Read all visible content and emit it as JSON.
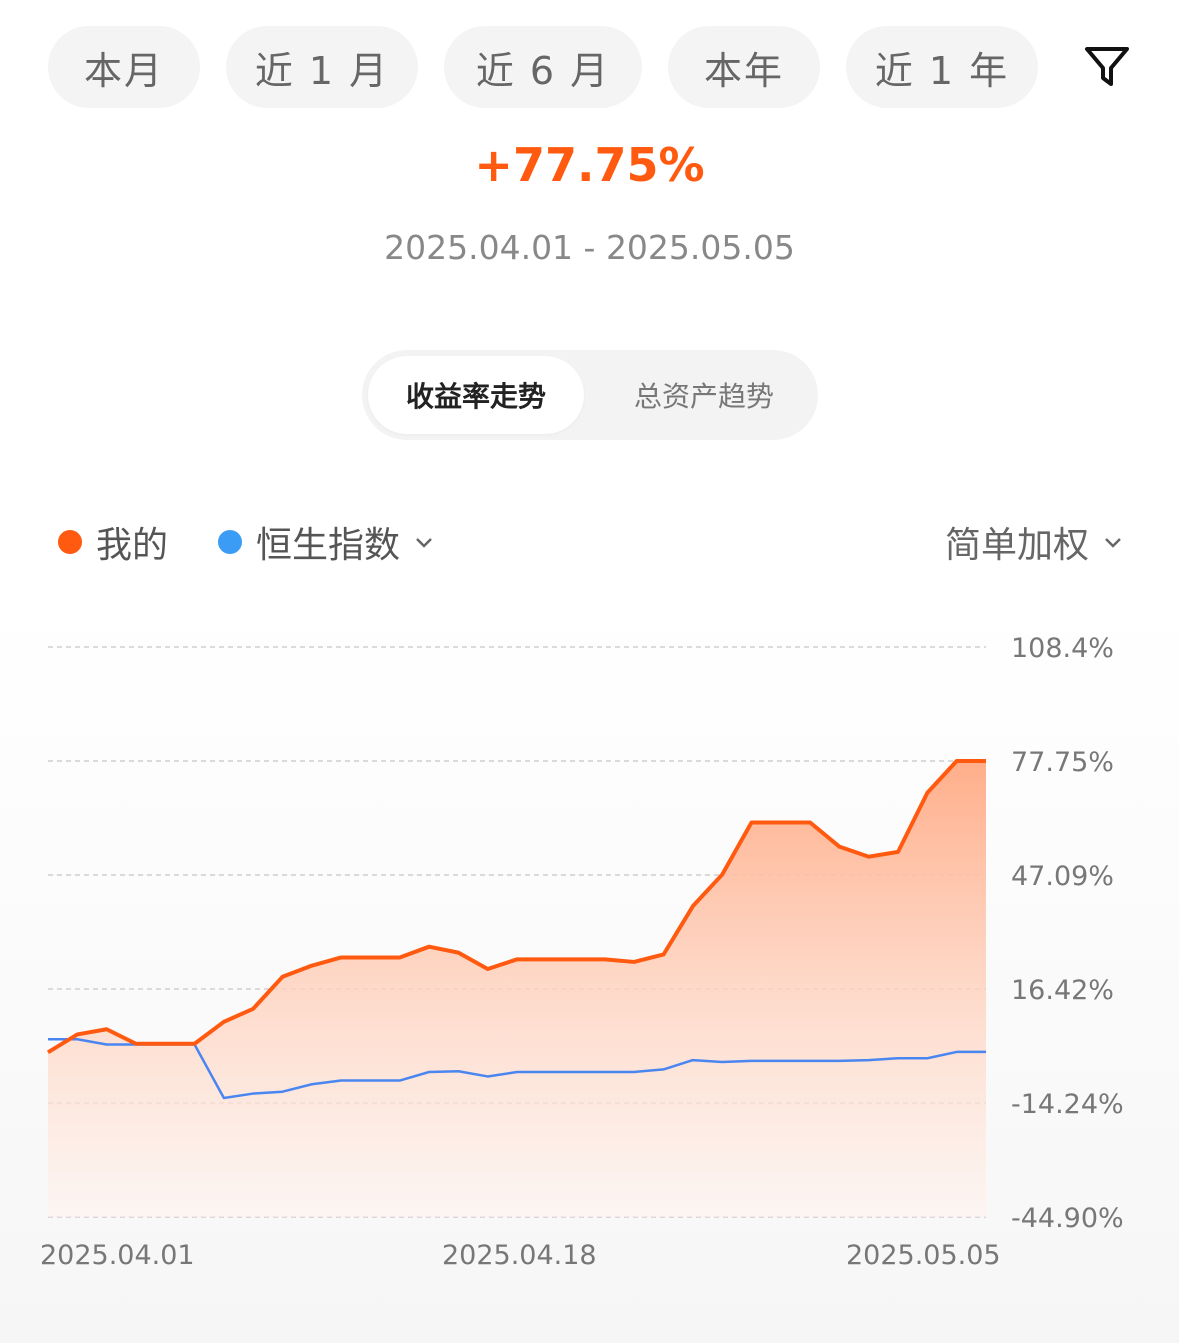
{
  "period_tabs": [
    {
      "label": "本月"
    },
    {
      "label": "近 1 月"
    },
    {
      "label": "近 6 月"
    },
    {
      "label": "本年"
    },
    {
      "label": "近 1 年"
    }
  ],
  "icons": {
    "filter": "filter-icon",
    "dropdown": "chevron-down-icon"
  },
  "summary": {
    "return_text": "+77.75%",
    "date_range": "2025.04.01 - 2025.05.05"
  },
  "view_tabs": {
    "active": "收益率走势",
    "inactive": "总资产趋势"
  },
  "legend": {
    "mine": "我的",
    "benchmark": "恒生指数",
    "method": "简单加权"
  },
  "colors": {
    "mine": "#ff5a0f",
    "benchmark": "#4a86f0",
    "benchmark_dot": "#3a9cf5",
    "accent": "#ff5a0f"
  },
  "chart_data": {
    "type": "area",
    "title": "",
    "xlabel": "",
    "ylabel": "",
    "x_ticks": [
      "2025.04.01",
      "2025.04.18",
      "2025.05.05"
    ],
    "y_ticks": [
      "108.4%",
      "77.75%",
      "47.09%",
      "16.42%",
      "-14.24%",
      "-44.90%"
    ],
    "ylim": [
      -44.9,
      108.4
    ],
    "grid": true,
    "legend_position": "top-left",
    "series": [
      {
        "name": "我的",
        "fill": "gradient",
        "points": [
          [
            "2025.04.01",
            -0.6
          ],
          [
            "2025.04.02",
            4.2
          ],
          [
            "2025.04.03",
            5.6
          ],
          [
            "2025.04.04",
            1.7
          ],
          [
            "2025.04.07",
            1.7
          ],
          [
            "2025.04.08",
            1.7
          ],
          [
            "2025.04.09",
            7.6
          ],
          [
            "2025.04.10",
            11.1
          ],
          [
            "2025.04.11",
            19.7
          ],
          [
            "2025.04.14",
            22.7
          ],
          [
            "2025.04.15",
            24.9
          ],
          [
            "2025.04.16",
            24.9
          ],
          [
            "2025.04.17",
            24.9
          ],
          [
            "2025.04.18",
            27.8
          ],
          [
            "2025.04.21",
            26.2
          ],
          [
            "2025.04.22",
            21.8
          ],
          [
            "2025.04.23",
            24.4
          ],
          [
            "2025.04.24",
            24.4
          ],
          [
            "2025.04.25",
            24.4
          ],
          [
            "2025.04.26",
            24.4
          ],
          [
            "2025.04.27",
            23.7
          ],
          [
            "2025.04.28",
            25.7
          ],
          [
            "2025.04.29",
            38.7
          ],
          [
            "2025.04.30",
            47.2
          ],
          [
            "2025.05.01",
            61.2
          ],
          [
            "2025.05.02",
            61.2
          ],
          [
            "2025.05.03",
            61.2
          ],
          [
            "2025.05.04",
            54.7
          ],
          [
            "2025.05.05",
            52.0
          ],
          [
            "2025.05.05",
            53.3
          ],
          [
            "2025.05.05",
            69.2
          ],
          [
            "2025.05.05",
            77.75
          ],
          [
            "2025.05.05",
            77.75
          ]
        ]
      },
      {
        "name": "恒生指数",
        "fill": "none",
        "points": [
          [
            "2025.04.01",
            2.9
          ],
          [
            "2025.04.02",
            2.9
          ],
          [
            "2025.04.03",
            1.5
          ],
          [
            "2025.04.04",
            1.5
          ],
          [
            "2025.04.07",
            1.5
          ],
          [
            "2025.04.08",
            1.5
          ],
          [
            "2025.04.09",
            -12.9
          ],
          [
            "2025.04.10",
            -11.7
          ],
          [
            "2025.04.11",
            -11.2
          ],
          [
            "2025.04.14",
            -9.2
          ],
          [
            "2025.04.15",
            -8.2
          ],
          [
            "2025.04.16",
            -8.2
          ],
          [
            "2025.04.17",
            -8.2
          ],
          [
            "2025.04.18",
            -5.9
          ],
          [
            "2025.04.21",
            -5.7
          ],
          [
            "2025.04.22",
            -7.1
          ],
          [
            "2025.04.23",
            -5.9
          ],
          [
            "2025.04.24",
            -5.9
          ],
          [
            "2025.04.25",
            -5.9
          ],
          [
            "2025.04.26",
            -5.9
          ],
          [
            "2025.04.27",
            -5.9
          ],
          [
            "2025.04.28",
            -5.2
          ],
          [
            "2025.04.29",
            -2.7
          ],
          [
            "2025.04.30",
            -3.2
          ],
          [
            "2025.05.01",
            -2.9
          ],
          [
            "2025.05.02",
            -2.9
          ],
          [
            "2025.05.03",
            -2.9
          ],
          [
            "2025.05.04",
            -2.9
          ],
          [
            "2025.05.05",
            -2.7
          ],
          [
            "2025.05.05",
            -2.2
          ],
          [
            "2025.05.05",
            -2.2
          ],
          [
            "2025.05.05",
            -0.5
          ],
          [
            "2025.05.05",
            -0.5
          ]
        ]
      }
    ]
  }
}
